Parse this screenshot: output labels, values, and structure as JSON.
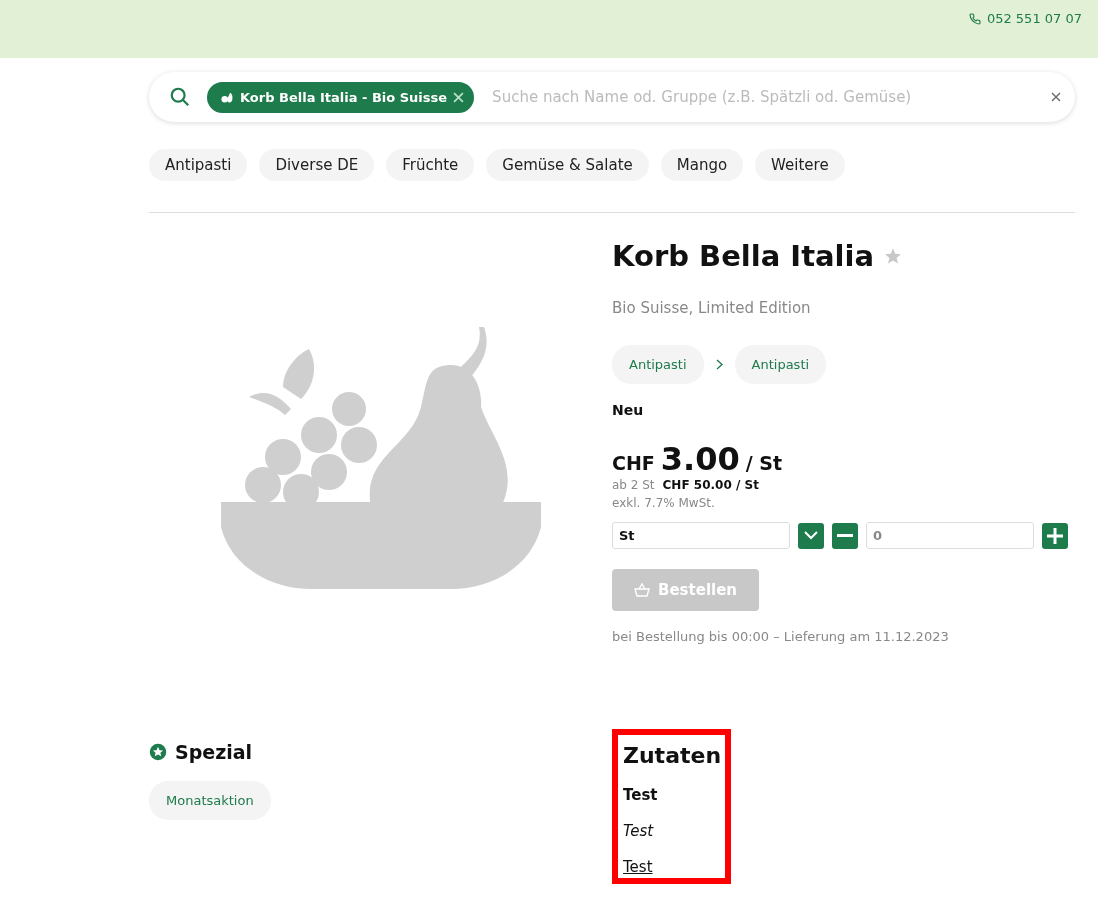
{
  "top_bar": {
    "phone": "052 551 07 07"
  },
  "search": {
    "filter_tag": "Korb Bella Italia - Bio Suisse",
    "placeholder": "Suche nach Name od. Gruppe (z.B. Spätzli od. Gemüse)"
  },
  "categories": [
    "Antipasti",
    "Diverse DE",
    "Früchte",
    "Gemüse & Salate",
    "Mango",
    "Weitere"
  ],
  "product": {
    "title": "Korb Bella Italia",
    "favorite": false,
    "labels": "Bio Suisse, Limited Edition",
    "breadcrumb": [
      "Antipasti",
      "Antipasti"
    ],
    "status": "Neu",
    "price": {
      "currency": "CHF",
      "amount": "3.00",
      "unit": "/ St"
    },
    "tier_price": {
      "label": "ab 2 St",
      "price": "CHF 50.00 / St"
    },
    "vat": "exkl. 7.7% MwSt.",
    "unit_select": "St",
    "quantity": "0",
    "order_button": {
      "label": "Bestellen",
      "disabled": true
    },
    "delivery": "bei Bestellung bis 00:00 – Lieferung am 11.12.2023"
  },
  "special": {
    "title": "Spezial",
    "tags": [
      "Monatsaktion"
    ]
  },
  "ingredients": {
    "title": "Zutaten",
    "lines": [
      {
        "kind": "bold",
        "text": "Test"
      },
      {
        "kind": "italic",
        "text": "Test"
      },
      {
        "kind": "link",
        "text": "Test"
      }
    ]
  }
}
